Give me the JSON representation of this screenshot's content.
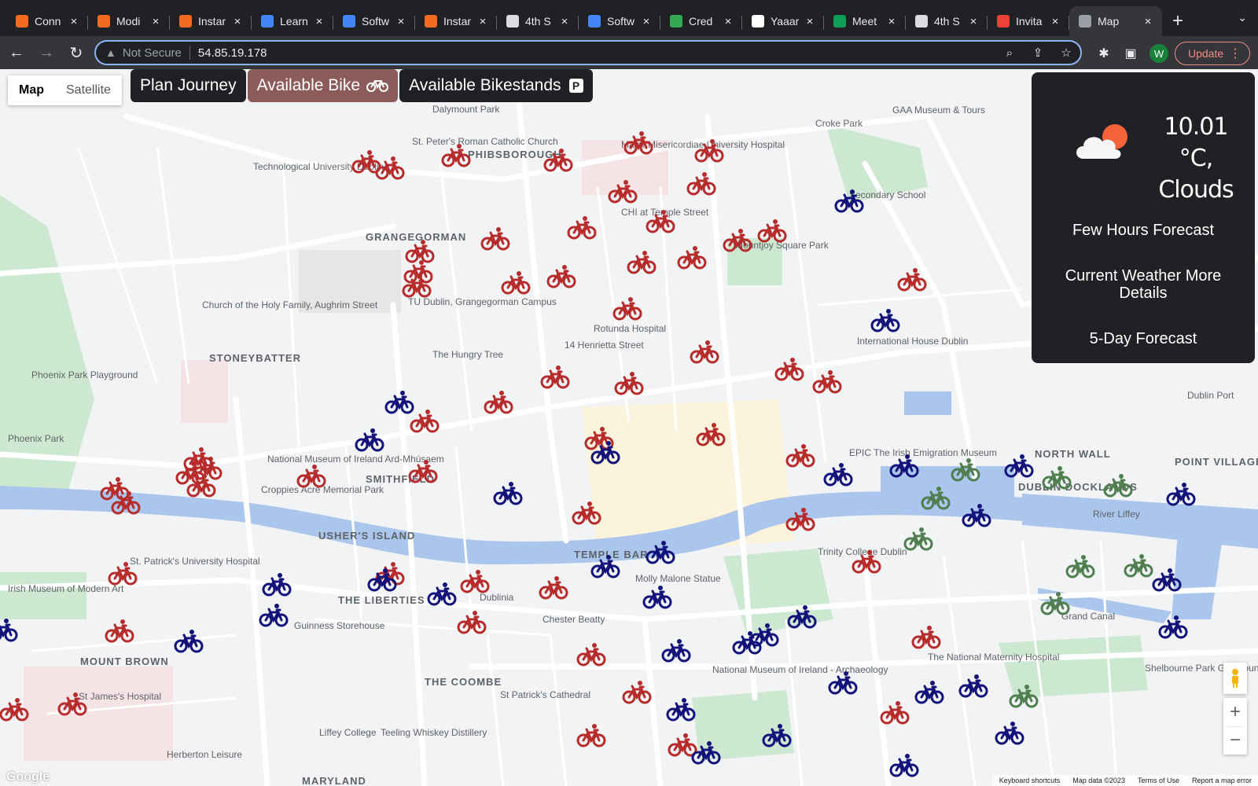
{
  "browser": {
    "tabs": [
      {
        "title": "Conn",
        "fav": "#f26b21"
      },
      {
        "title": "Modi",
        "fav": "#f26b21"
      },
      {
        "title": "Instar",
        "fav": "#f26b21"
      },
      {
        "title": "Learn",
        "fav": "#4285f4"
      },
      {
        "title": "Softw",
        "fav": "#4285f4"
      },
      {
        "title": "Instar",
        "fav": "#f26b21"
      },
      {
        "title": "4th S",
        "fav": "#dadce0"
      },
      {
        "title": "Softw",
        "fav": "#4285f4"
      },
      {
        "title": "Cred",
        "fav": "#34a853"
      },
      {
        "title": "Yaaar",
        "fav": "#ffffff"
      },
      {
        "title": "Meet",
        "fav": "#0f9d58"
      },
      {
        "title": "4th S",
        "fav": "#dadce0"
      },
      {
        "title": "Invita",
        "fav": "#ea4335"
      },
      {
        "title": "Map",
        "fav": "#9aa0a6",
        "active": true
      }
    ],
    "security": "Not Secure",
    "url": "54.85.19.178",
    "profile_initial": "W",
    "update_label": "Update"
  },
  "map_controls": {
    "map_label": "Map",
    "satellite_label": "Satellite"
  },
  "menu": {
    "plan": "Plan Journey",
    "bike": "Available Bike",
    "stands": "Available Bikestands",
    "stands_badge": "P"
  },
  "weather": {
    "temp": "10.01 °C,",
    "desc": "Clouds",
    "items": [
      "Few Hours Forecast",
      "Current Weather More Details",
      "5-Day Forecast"
    ]
  },
  "footer": {
    "logo": "Google",
    "shortcuts": "Keyboard shortcuts",
    "mapdata": "Map data ©2023",
    "terms": "Terms of Use",
    "report": "Report a map error"
  },
  "map_labels": [
    {
      "t": "PHIBSBOROUGH"
    },
    {
      "t": "GRANGEGORMAN"
    },
    {
      "t": "STONEYBATTER"
    },
    {
      "t": "SMITHFIELD"
    },
    {
      "t": "USHER'S ISLAND"
    },
    {
      "t": "TEMPLE BAR"
    },
    {
      "t": "THE LIBERTIES"
    },
    {
      "t": "NORTH WALL"
    },
    {
      "t": "DUBLIN DOCKLANDS"
    },
    {
      "t": "POINT VILLAGE"
    },
    {
      "t": "MOUNT BROWN"
    },
    {
      "t": "THE COOMBE"
    },
    {
      "t": "MARYLAND"
    },
    {
      "t": "River Liffey"
    },
    {
      "t": "Croke Park"
    },
    {
      "t": "Rotunda Hospital"
    },
    {
      "t": "Trinity College Dublin"
    },
    {
      "t": "Guinness Storehouse"
    },
    {
      "t": "Dublinia"
    },
    {
      "t": "Chester Beatty"
    },
    {
      "t": "St Patrick's Cathedral"
    },
    {
      "t": "Phoenix Park Playground"
    },
    {
      "t": "Mater Misericordiae University Hospital"
    },
    {
      "t": "Mountjoy Square Park"
    },
    {
      "t": "The Hungry Tree"
    },
    {
      "t": "14 Henrietta Street"
    },
    {
      "t": "International House Dublin"
    },
    {
      "t": "EPIC The Irish Emigration Museum"
    },
    {
      "t": "Irish Museum of Modern Art"
    },
    {
      "t": "St James's Hospital"
    },
    {
      "t": "National Museum of Ireland - Archaeology"
    },
    {
      "t": "The National Maternity Hospital"
    },
    {
      "t": "Shelbourne Park Greyhound Stadium"
    },
    {
      "t": "Liffey College"
    },
    {
      "t": "Teeling Whiskey Distillery"
    },
    {
      "t": "Molly Malone Statue"
    },
    {
      "t": "Herberton Leisure"
    },
    {
      "t": "Technological University Dublin"
    },
    {
      "t": "TU Dublin, Grangegorman Campus"
    },
    {
      "t": "Church of the Holy Family, Aughrim Street"
    },
    {
      "t": "St. Patrick's University Hospital"
    },
    {
      "t": "GAA Museum & Tours"
    },
    {
      "t": "Dalymount Park"
    },
    {
      "t": "Croppies Acre Memorial Park"
    },
    {
      "t": "Dublin Port"
    },
    {
      "t": "CHI at Temple Street"
    },
    {
      "t": "Secondary School"
    },
    {
      "t": "St. Peter's Roman Catholic Church"
    },
    {
      "t": "National Museum of Ireland Ard-Mhúsaem"
    },
    {
      "t": "Phoenix Park"
    },
    {
      "t": "Grand Canal"
    }
  ]
}
